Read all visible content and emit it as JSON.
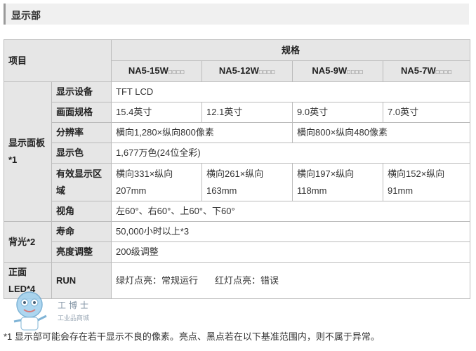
{
  "section_title": "显示部",
  "table": {
    "header": {
      "item_label": "项目",
      "spec_label": "规格",
      "models": [
        {
          "name": "NA5-15W",
          "suffix": "□□□□"
        },
        {
          "name": "NA5-12W",
          "suffix": "□□□□"
        },
        {
          "name": "NA5-9W",
          "suffix": "□□□□"
        },
        {
          "name": "NA5-7W",
          "suffix": "□□□□"
        }
      ]
    },
    "panel": {
      "group_label": "显示面板*1",
      "device": {
        "label": "显示设备",
        "value": "TFT LCD"
      },
      "screen": {
        "label": "画面规格",
        "values": [
          "15.4英寸",
          "12.1英寸",
          "9.0英寸",
          "7.0英寸"
        ]
      },
      "resolution": {
        "label": "分辨率",
        "values": [
          "横向1,280×纵向800像素",
          "横向800×纵向480像素"
        ]
      },
      "colors": {
        "label": "显示色",
        "value": "1,677万色(24位全彩)"
      },
      "area": {
        "label": "有效显示区域",
        "values": [
          "横向331×纵向207mm",
          "横向261×纵向163mm",
          "横向197×纵向118mm",
          "横向152×纵向91mm"
        ]
      },
      "viewing": {
        "label": "视角",
        "value": "左60°、右60°、上60°、下60°"
      }
    },
    "backlight": {
      "group_label": "背光*2",
      "life": {
        "label": "寿命",
        "value": "50,000小时以上*3"
      },
      "brightness": {
        "label": "亮度调整",
        "value": "200级调整"
      }
    },
    "led": {
      "group_label": "正面LED*4",
      "run": {
        "label": "RUN",
        "green": "绿灯点亮：常规运行",
        "red": "红灯点亮：错误"
      }
    }
  },
  "footnote": "*1 显示部可能会存在若干显示不良的像素。亮点、黑点若在以下基准范围内，则不属于异常。",
  "watermark": {
    "text1": "工博士",
    "text2": "工业品商城"
  }
}
